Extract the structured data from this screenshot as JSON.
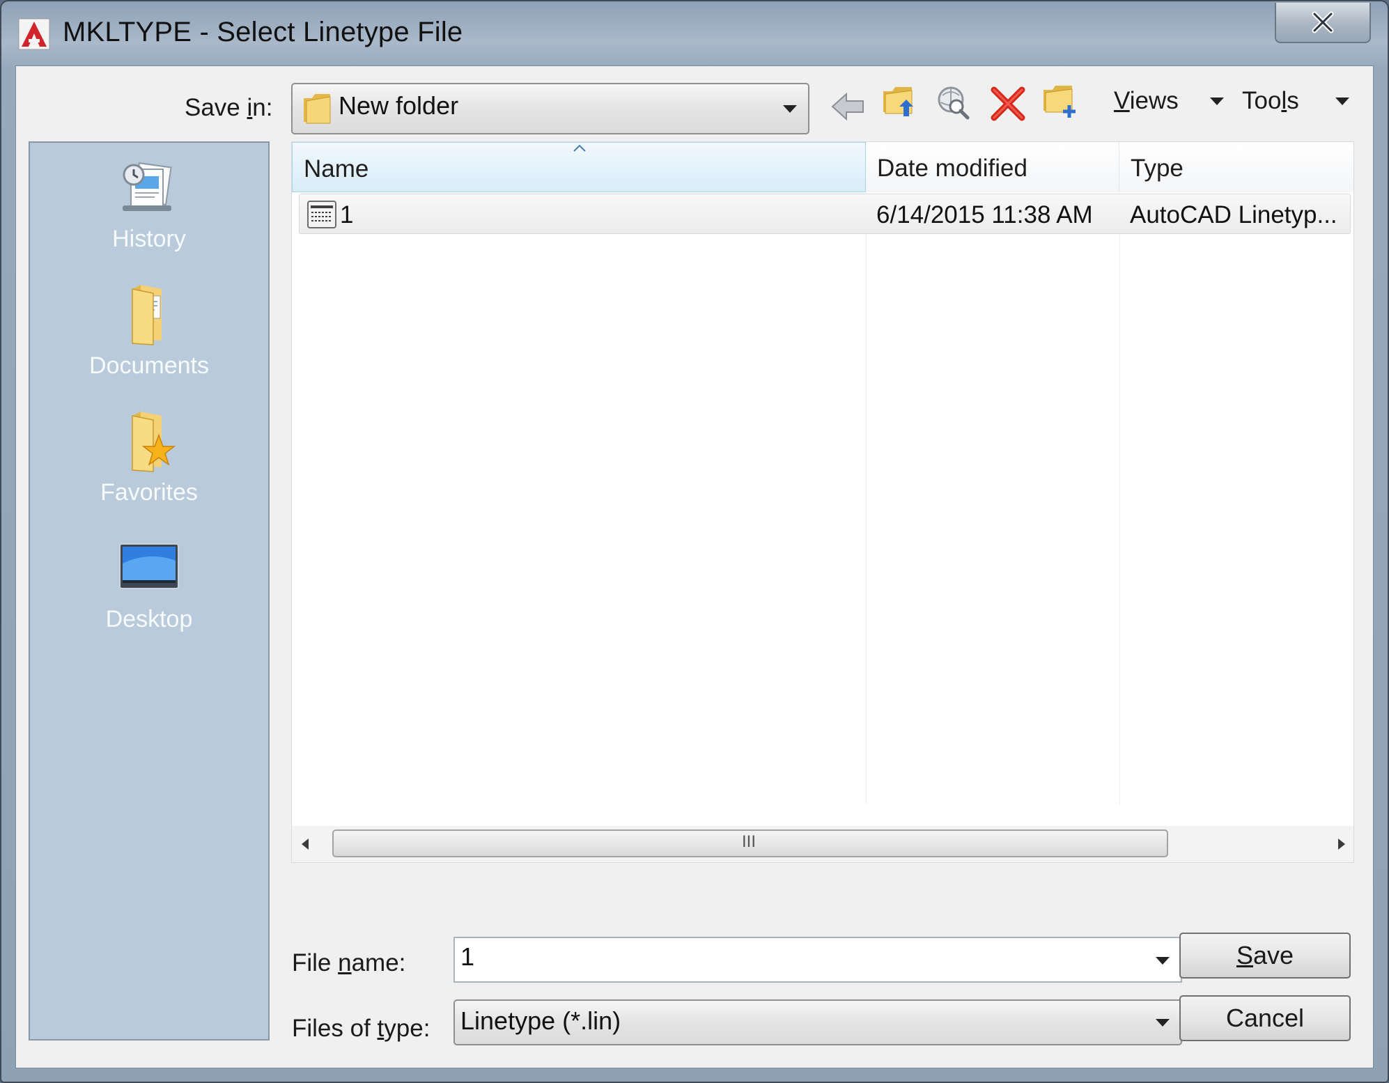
{
  "window": {
    "title": "MKLTYPE - Select Linetype File",
    "app_icon": "autocad-a-icon",
    "close_icon": "close-x-icon"
  },
  "toolbar": {
    "save_in_label_pre": "Save ",
    "save_in_label_u": "i",
    "save_in_label_post": "n:",
    "location": "New folder",
    "location_icon": "folder-icon",
    "icons": [
      "back-arrow-icon",
      "up-one-level-icon",
      "search-web-icon",
      "delete-icon",
      "create-new-folder-icon"
    ],
    "views_u": "V",
    "views_rest": "iews",
    "tools_pre": "Too",
    "tools_u": "l",
    "tools_post": "s"
  },
  "places": [
    {
      "label": "History",
      "icon": "history-icon"
    },
    {
      "label": "Documents",
      "icon": "documents-folder-icon"
    },
    {
      "label": "Favorites",
      "icon": "favorites-folder-icon"
    },
    {
      "label": "Desktop",
      "icon": "desktop-monitor-icon"
    }
  ],
  "filelist": {
    "columns": [
      "Name",
      "Date modified",
      "Type"
    ],
    "sorted_column": "Name",
    "rows": [
      {
        "name": "1",
        "date": "6/14/2015 11:38 AM",
        "type": "AutoCAD Linetyp...",
        "icon": "linetype-file-icon"
      }
    ],
    "scroll_grip": "III"
  },
  "bottom": {
    "file_name_label_pre": "File ",
    "file_name_label_u": "n",
    "file_name_label_post": "ame:",
    "file_name_value": "1",
    "files_of_type_label_pre": "Files of ",
    "files_of_type_label_u": "t",
    "files_of_type_label_post": "ype:",
    "files_of_type_value": "Linetype (*.lin)",
    "save_u": "S",
    "save_rest": "ave",
    "cancel": "Cancel"
  },
  "colors": {
    "places_bg": "#b9cadb",
    "title_bar": "#a9b9ca",
    "delete_red": "#d42a1e",
    "folder_yellow": "#f2c94c"
  }
}
